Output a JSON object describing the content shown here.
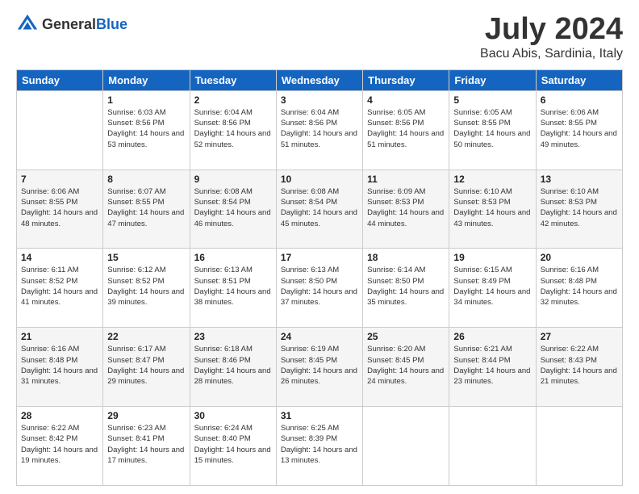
{
  "header": {
    "logo_general": "General",
    "logo_blue": "Blue",
    "month": "July 2024",
    "location": "Bacu Abis, Sardinia, Italy"
  },
  "weekdays": [
    "Sunday",
    "Monday",
    "Tuesday",
    "Wednesday",
    "Thursday",
    "Friday",
    "Saturday"
  ],
  "weeks": [
    [
      {
        "day": "",
        "sunrise": "",
        "sunset": "",
        "daylight": ""
      },
      {
        "day": "1",
        "sunrise": "Sunrise: 6:03 AM",
        "sunset": "Sunset: 8:56 PM",
        "daylight": "Daylight: 14 hours and 53 minutes."
      },
      {
        "day": "2",
        "sunrise": "Sunrise: 6:04 AM",
        "sunset": "Sunset: 8:56 PM",
        "daylight": "Daylight: 14 hours and 52 minutes."
      },
      {
        "day": "3",
        "sunrise": "Sunrise: 6:04 AM",
        "sunset": "Sunset: 8:56 PM",
        "daylight": "Daylight: 14 hours and 51 minutes."
      },
      {
        "day": "4",
        "sunrise": "Sunrise: 6:05 AM",
        "sunset": "Sunset: 8:56 PM",
        "daylight": "Daylight: 14 hours and 51 minutes."
      },
      {
        "day": "5",
        "sunrise": "Sunrise: 6:05 AM",
        "sunset": "Sunset: 8:55 PM",
        "daylight": "Daylight: 14 hours and 50 minutes."
      },
      {
        "day": "6",
        "sunrise": "Sunrise: 6:06 AM",
        "sunset": "Sunset: 8:55 PM",
        "daylight": "Daylight: 14 hours and 49 minutes."
      }
    ],
    [
      {
        "day": "7",
        "sunrise": "Sunrise: 6:06 AM",
        "sunset": "Sunset: 8:55 PM",
        "daylight": "Daylight: 14 hours and 48 minutes."
      },
      {
        "day": "8",
        "sunrise": "Sunrise: 6:07 AM",
        "sunset": "Sunset: 8:55 PM",
        "daylight": "Daylight: 14 hours and 47 minutes."
      },
      {
        "day": "9",
        "sunrise": "Sunrise: 6:08 AM",
        "sunset": "Sunset: 8:54 PM",
        "daylight": "Daylight: 14 hours and 46 minutes."
      },
      {
        "day": "10",
        "sunrise": "Sunrise: 6:08 AM",
        "sunset": "Sunset: 8:54 PM",
        "daylight": "Daylight: 14 hours and 45 minutes."
      },
      {
        "day": "11",
        "sunrise": "Sunrise: 6:09 AM",
        "sunset": "Sunset: 8:53 PM",
        "daylight": "Daylight: 14 hours and 44 minutes."
      },
      {
        "day": "12",
        "sunrise": "Sunrise: 6:10 AM",
        "sunset": "Sunset: 8:53 PM",
        "daylight": "Daylight: 14 hours and 43 minutes."
      },
      {
        "day": "13",
        "sunrise": "Sunrise: 6:10 AM",
        "sunset": "Sunset: 8:53 PM",
        "daylight": "Daylight: 14 hours and 42 minutes."
      }
    ],
    [
      {
        "day": "14",
        "sunrise": "Sunrise: 6:11 AM",
        "sunset": "Sunset: 8:52 PM",
        "daylight": "Daylight: 14 hours and 41 minutes."
      },
      {
        "day": "15",
        "sunrise": "Sunrise: 6:12 AM",
        "sunset": "Sunset: 8:52 PM",
        "daylight": "Daylight: 14 hours and 39 minutes."
      },
      {
        "day": "16",
        "sunrise": "Sunrise: 6:13 AM",
        "sunset": "Sunset: 8:51 PM",
        "daylight": "Daylight: 14 hours and 38 minutes."
      },
      {
        "day": "17",
        "sunrise": "Sunrise: 6:13 AM",
        "sunset": "Sunset: 8:50 PM",
        "daylight": "Daylight: 14 hours and 37 minutes."
      },
      {
        "day": "18",
        "sunrise": "Sunrise: 6:14 AM",
        "sunset": "Sunset: 8:50 PM",
        "daylight": "Daylight: 14 hours and 35 minutes."
      },
      {
        "day": "19",
        "sunrise": "Sunrise: 6:15 AM",
        "sunset": "Sunset: 8:49 PM",
        "daylight": "Daylight: 14 hours and 34 minutes."
      },
      {
        "day": "20",
        "sunrise": "Sunrise: 6:16 AM",
        "sunset": "Sunset: 8:48 PM",
        "daylight": "Daylight: 14 hours and 32 minutes."
      }
    ],
    [
      {
        "day": "21",
        "sunrise": "Sunrise: 6:16 AM",
        "sunset": "Sunset: 8:48 PM",
        "daylight": "Daylight: 14 hours and 31 minutes."
      },
      {
        "day": "22",
        "sunrise": "Sunrise: 6:17 AM",
        "sunset": "Sunset: 8:47 PM",
        "daylight": "Daylight: 14 hours and 29 minutes."
      },
      {
        "day": "23",
        "sunrise": "Sunrise: 6:18 AM",
        "sunset": "Sunset: 8:46 PM",
        "daylight": "Daylight: 14 hours and 28 minutes."
      },
      {
        "day": "24",
        "sunrise": "Sunrise: 6:19 AM",
        "sunset": "Sunset: 8:45 PM",
        "daylight": "Daylight: 14 hours and 26 minutes."
      },
      {
        "day": "25",
        "sunrise": "Sunrise: 6:20 AM",
        "sunset": "Sunset: 8:45 PM",
        "daylight": "Daylight: 14 hours and 24 minutes."
      },
      {
        "day": "26",
        "sunrise": "Sunrise: 6:21 AM",
        "sunset": "Sunset: 8:44 PM",
        "daylight": "Daylight: 14 hours and 23 minutes."
      },
      {
        "day": "27",
        "sunrise": "Sunrise: 6:22 AM",
        "sunset": "Sunset: 8:43 PM",
        "daylight": "Daylight: 14 hours and 21 minutes."
      }
    ],
    [
      {
        "day": "28",
        "sunrise": "Sunrise: 6:22 AM",
        "sunset": "Sunset: 8:42 PM",
        "daylight": "Daylight: 14 hours and 19 minutes."
      },
      {
        "day": "29",
        "sunrise": "Sunrise: 6:23 AM",
        "sunset": "Sunset: 8:41 PM",
        "daylight": "Daylight: 14 hours and 17 minutes."
      },
      {
        "day": "30",
        "sunrise": "Sunrise: 6:24 AM",
        "sunset": "Sunset: 8:40 PM",
        "daylight": "Daylight: 14 hours and 15 minutes."
      },
      {
        "day": "31",
        "sunrise": "Sunrise: 6:25 AM",
        "sunset": "Sunset: 8:39 PM",
        "daylight": "Daylight: 14 hours and 13 minutes."
      },
      {
        "day": "",
        "sunrise": "",
        "sunset": "",
        "daylight": ""
      },
      {
        "day": "",
        "sunrise": "",
        "sunset": "",
        "daylight": ""
      },
      {
        "day": "",
        "sunrise": "",
        "sunset": "",
        "daylight": ""
      }
    ]
  ]
}
